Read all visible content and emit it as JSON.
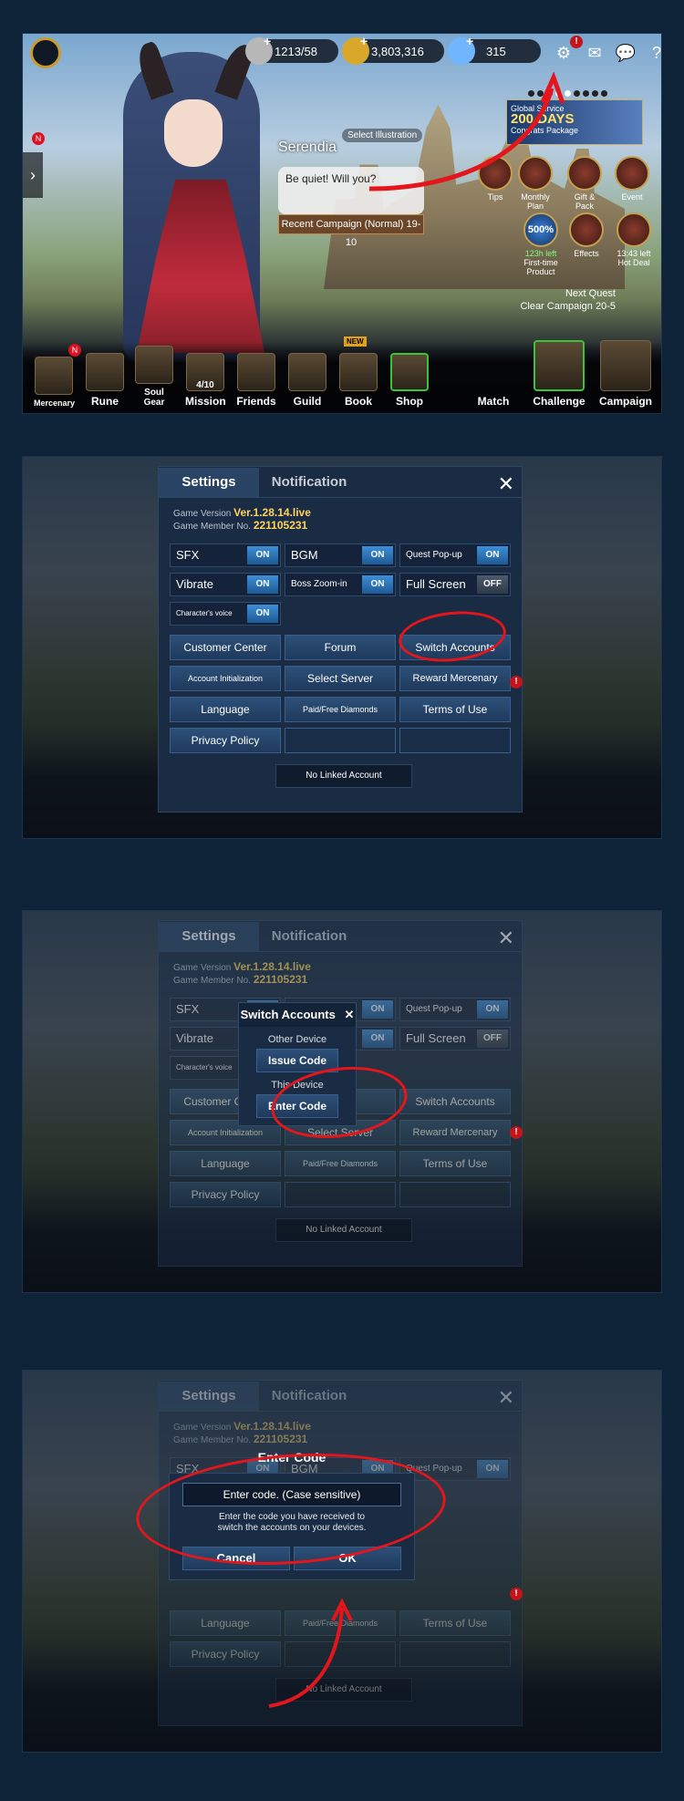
{
  "hud": {
    "stamina": "1213/58",
    "gold": "3,803,316",
    "diamonds": "315"
  },
  "lobby": {
    "select_illustration": "Select Illustration",
    "npc_name": "Serendia",
    "npc_line": "Be quiet! Will you?",
    "recent_campaign": "Recent Campaign (Normal) 19-10",
    "banner_line1": "Global Service",
    "banner_days": "200 DAYS",
    "banner_line2": "Congrats Package",
    "right_icons": {
      "tips": "Tips",
      "monthly_plan": "Monthly Plan",
      "gift_pack": "Gift & Pack",
      "event": "Event",
      "first_time_value": "500%",
      "first_time_timer": "123h left",
      "first_time_label": "First-time Product",
      "effects": "Effects",
      "hot_deal_timer": "13:43 left",
      "hot_deal": "Hot Deal"
    },
    "next_quest_title": "Next Quest",
    "next_quest_text": "Clear Campaign 20-5",
    "bottom": {
      "mercenary": "Mercenary",
      "rune": "Rune",
      "soul_gear": "Soul Gear",
      "mission": "Mission",
      "mission_count": "4/10",
      "friends": "Friends",
      "guild": "Guild",
      "book": "Book",
      "book_badge": "NEW",
      "shop": "Shop",
      "match": "Match",
      "challenge": "Challenge",
      "campaign": "Campaign",
      "badge_n": "N"
    }
  },
  "settings": {
    "tab_settings": "Settings",
    "tab_notification": "Notification",
    "game_version_label": "Game Version",
    "game_version": "Ver.1.28.14.live",
    "member_label": "Game Member No.",
    "member_no": "221105231",
    "sfx": "SFX",
    "bgm": "BGM",
    "quest_popup": "Quest Pop-up",
    "vibrate": "Vibrate",
    "boss_zoom": "Boss Zoom-in",
    "full_screen": "Full Screen",
    "character_voice": "Character's voice",
    "on": "ON",
    "off": "OFF",
    "customer_center": "Customer Center",
    "forum": "Forum",
    "switch_accounts": "Switch Accounts",
    "account_init": "Account Initialization",
    "select_server": "Select Server",
    "reward_mercenary": "Reward Mercenary",
    "language": "Language",
    "paid_free": "Paid/Free Diamonds",
    "terms": "Terms of Use",
    "privacy": "Privacy Policy",
    "no_linked": "No Linked Account"
  },
  "switch_dialog": {
    "title": "Switch Accounts",
    "other_device": "Other Device",
    "issue_code": "Issue Code",
    "this_device": "This Device",
    "enter_code": "Enter Code"
  },
  "code_dialog": {
    "title": "Enter Code",
    "placeholder": "Enter code. (Case sensitive)",
    "hint_line1": "Enter the code you have received to",
    "hint_line2": "switch the accounts on your devices.",
    "cancel": "Cancel",
    "ok": "OK"
  }
}
